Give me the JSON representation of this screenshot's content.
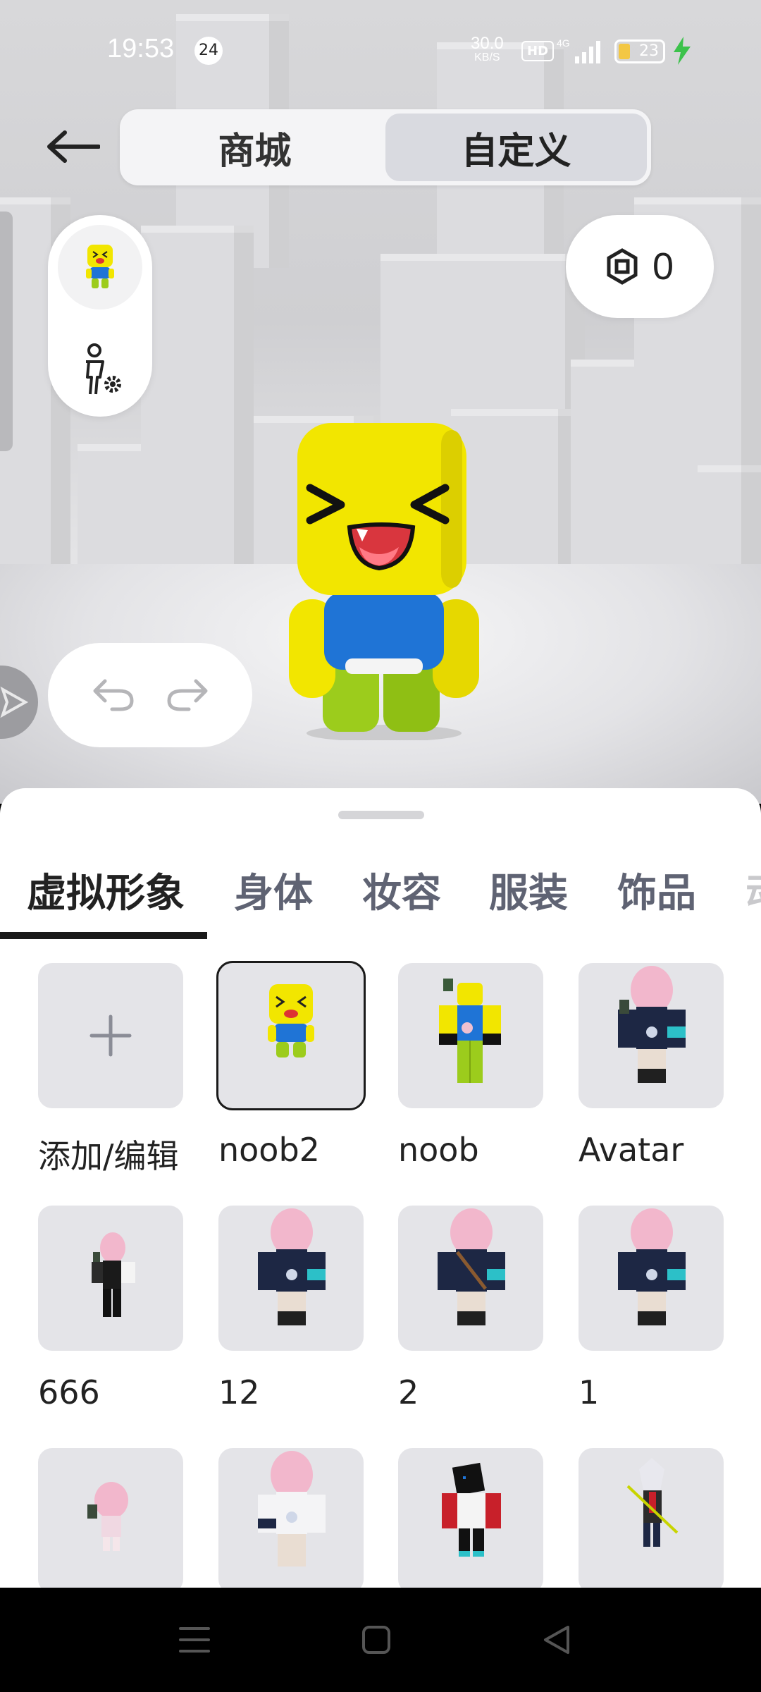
{
  "status_bar": {
    "time": "19:53",
    "notification_count": "24",
    "net_speed_value": "30.0",
    "net_speed_unit": "KB/S",
    "hd_label": "HD",
    "network_type": "4G",
    "battery_level": "23"
  },
  "header": {
    "tabs": [
      {
        "label": "商城",
        "active": false
      },
      {
        "label": "自定义",
        "active": true
      }
    ]
  },
  "robux": {
    "icon": "robux-icon",
    "count": "0"
  },
  "sheet": {
    "tabs": [
      {
        "label": "虚拟形象",
        "active": true
      },
      {
        "label": "身体",
        "active": false
      },
      {
        "label": "妆容",
        "active": false
      },
      {
        "label": "服装",
        "active": false
      },
      {
        "label": "饰品",
        "active": false
      },
      {
        "label": "动",
        "active": false
      }
    ],
    "items": [
      {
        "label": "添加/编辑",
        "kind": "add"
      },
      {
        "label": "noob2",
        "kind": "noob-face",
        "selected": true
      },
      {
        "label": "noob",
        "kind": "noob-classic"
      },
      {
        "label": "Avatar",
        "kind": "pink-avatar"
      },
      {
        "label": "666",
        "kind": "pink-suit"
      },
      {
        "label": "12",
        "kind": "pink-avatar"
      },
      {
        "label": "2",
        "kind": "pink-avatar"
      },
      {
        "label": "1",
        "kind": "pink-avatar"
      },
      {
        "label": "",
        "kind": "pink-small"
      },
      {
        "label": "",
        "kind": "pink-white"
      },
      {
        "label": "",
        "kind": "black-red"
      },
      {
        "label": "",
        "kind": "white-hair"
      }
    ]
  },
  "colors": {
    "accent_dark": "#1a1a1a",
    "tab_inactive": "#5f6373",
    "thumb_bg": "#e4e4e8",
    "noob_yellow": "#f2e600",
    "noob_blue": "#1f74d6",
    "noob_green": "#9ccc1c",
    "charging": "#3cc24b"
  }
}
